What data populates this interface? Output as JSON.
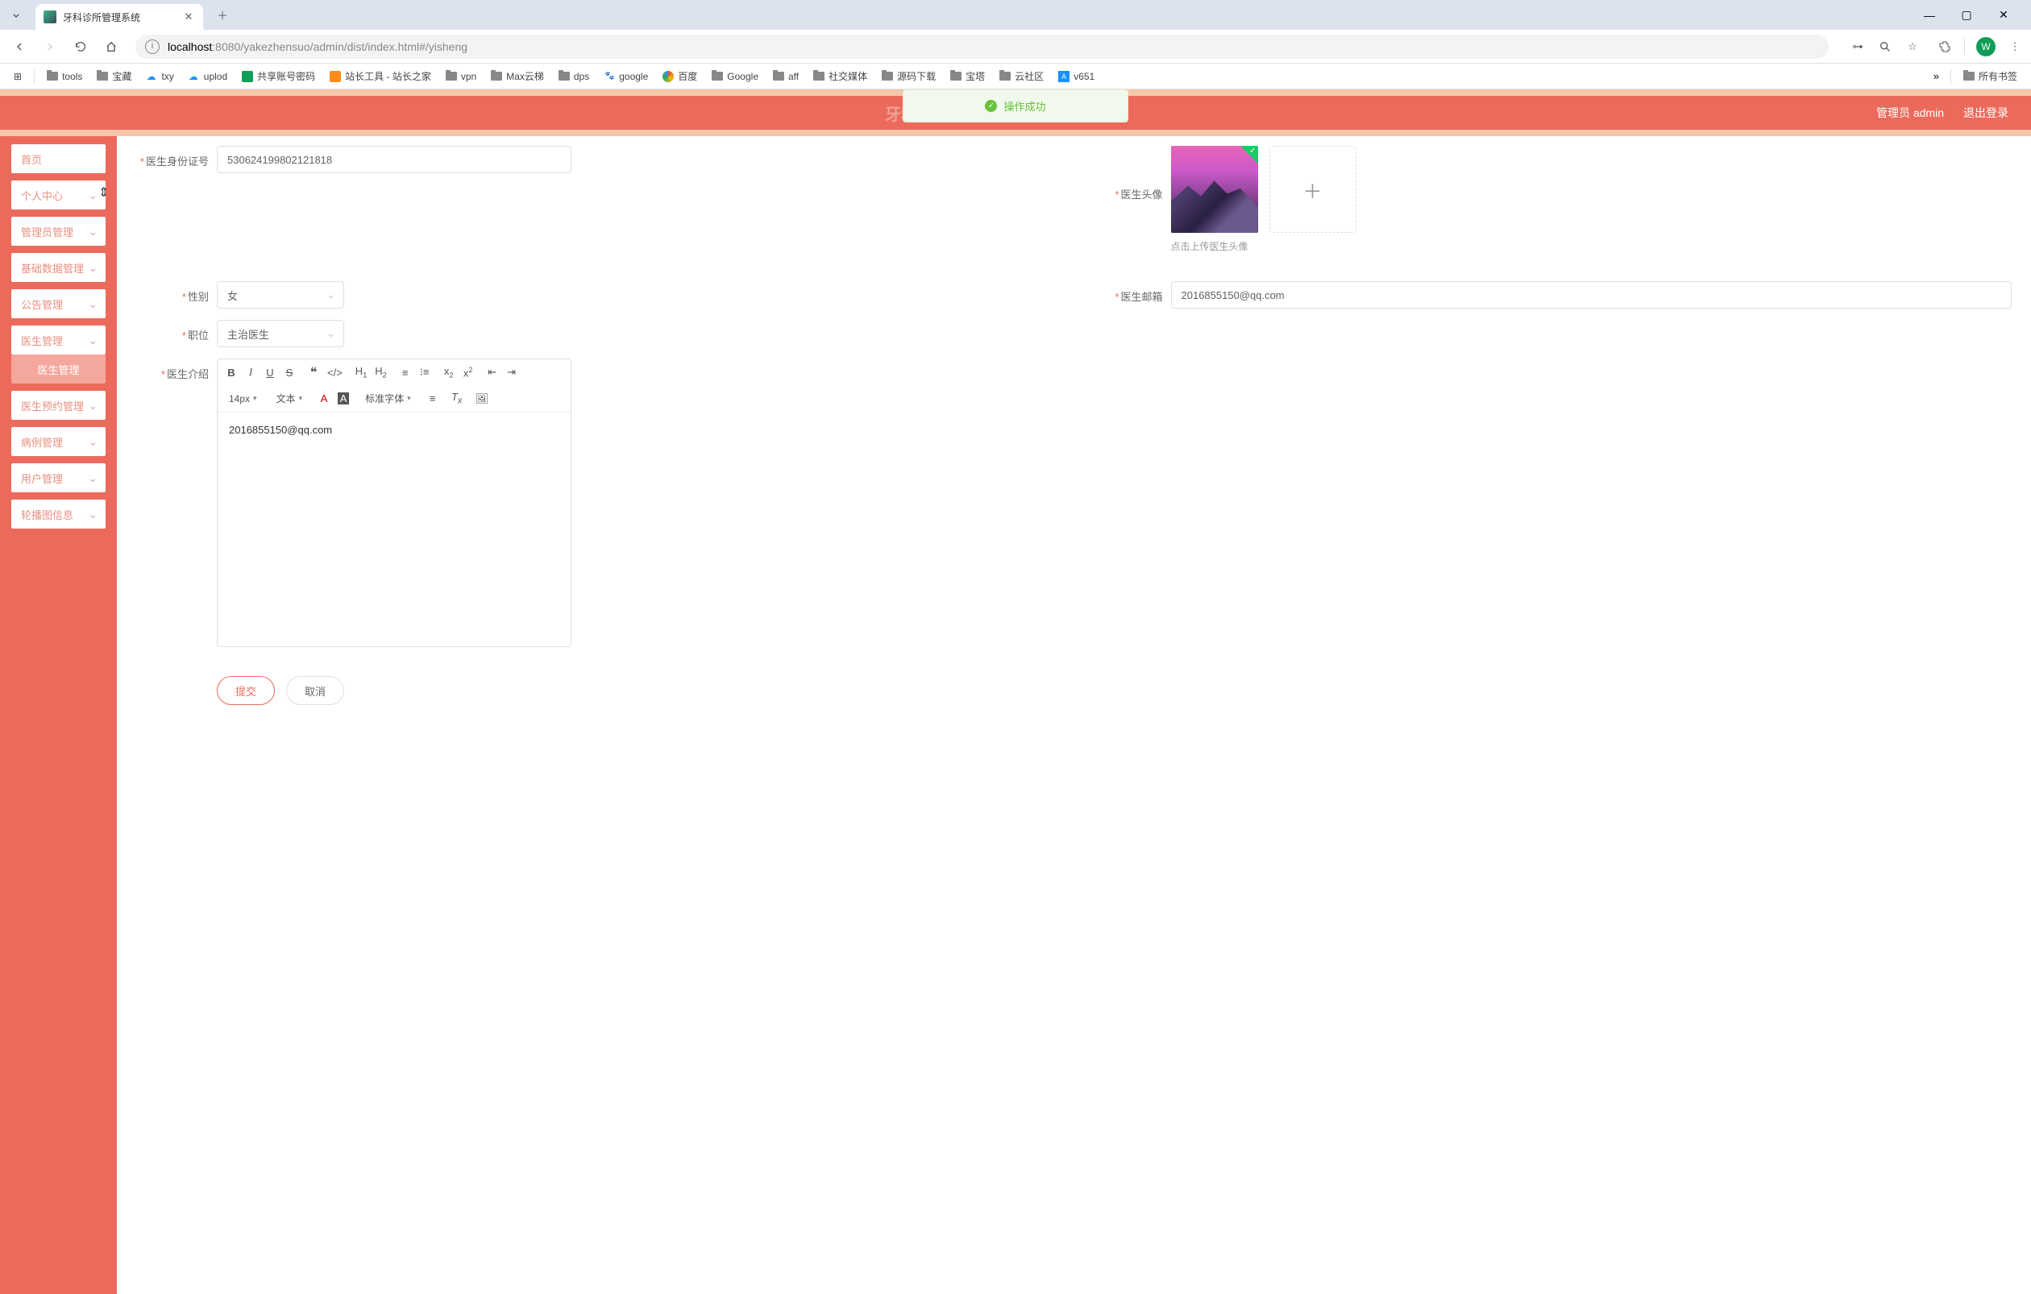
{
  "browser": {
    "tab_title": "牙科诊所管理系统",
    "url_host": "localhost",
    "url_port": ":8080",
    "url_path": "/yakezhensuo/admin/dist/index.html#/yisheng",
    "profile_letter": "W",
    "bookmarks": [
      "tools",
      "宝藏",
      "txy",
      "uplod",
      "共享账号密码",
      "站长工具 - 站长之家",
      "vpn",
      "Max云梯",
      "dps",
      "google",
      "百度",
      "Google",
      "aff",
      "社交媒体",
      "源码下载",
      "宝塔",
      "云社区",
      "v651"
    ],
    "bookmarks_right": "所有书签"
  },
  "toast": {
    "text": "操作成功"
  },
  "header": {
    "title": "牙科诊所管理系统",
    "user": "管理员 admin",
    "logout": "退出登录"
  },
  "sidebar": {
    "items": [
      {
        "label": "首页",
        "chevron": false,
        "sub": false
      },
      {
        "label": "个人中心",
        "chevron": true,
        "sub": false
      },
      {
        "label": "管理员管理",
        "chevron": true,
        "sub": false
      },
      {
        "label": "基础数据管理",
        "chevron": true,
        "sub": false
      },
      {
        "label": "公告管理",
        "chevron": true,
        "sub": false
      },
      {
        "label": "医生管理",
        "chevron": true,
        "sub": false
      },
      {
        "label": "医生管理",
        "chevron": false,
        "sub": true
      },
      {
        "label": "医生预约管理",
        "chevron": true,
        "sub": false
      },
      {
        "label": "病例管理",
        "chevron": true,
        "sub": false
      },
      {
        "label": "用户管理",
        "chevron": true,
        "sub": false
      },
      {
        "label": "轮播图信息",
        "chevron": true,
        "sub": false
      }
    ]
  },
  "form": {
    "id_label": "医生身份证号",
    "id_value": "530624199802121818",
    "avatar_label": "医生头像",
    "avatar_hint": "点击上传医生头像",
    "gender_label": "性别",
    "gender_value": "女",
    "email_label": "医生邮箱",
    "email_value": "2016855150@qq.com",
    "position_label": "职位",
    "position_value": "主治医生",
    "intro_label": "医生介绍",
    "intro_content": "2016855150@qq.com",
    "submit": "提交",
    "cancel": "取消"
  },
  "editor": {
    "fontsize": "14px",
    "blocktype": "文本",
    "fontfamily": "标准字体"
  }
}
